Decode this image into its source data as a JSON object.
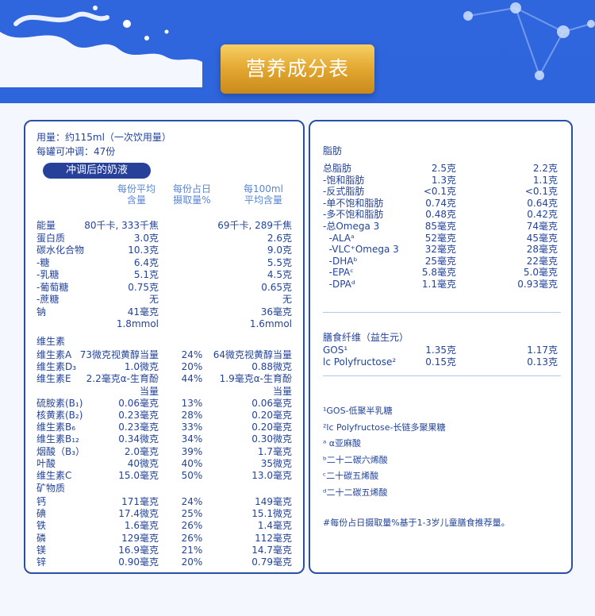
{
  "header": {
    "title": "营养成分表"
  },
  "left": {
    "dose": "用量：约115ml（一次饮用量）",
    "cans": "每罐可冲调：47份",
    "pill": "冲调后的奶液",
    "col1": [
      "每份平均",
      "含量"
    ],
    "col2": [
      "每份占日",
      "摄取量%"
    ],
    "col3": [
      "每100ml",
      "平均含量"
    ],
    "basic": [
      {
        "name": "能量",
        "a": "80千卡, 333千焦",
        "c": "69千卡, 289千焦"
      },
      {
        "name": "蛋白质",
        "a": "3.0克",
        "c": "2.6克"
      },
      {
        "name": "碳水化合物",
        "a": "10.3克",
        "c": "9.0克"
      },
      {
        "name": "-糖",
        "a": "6.4克",
        "c": "5.5克"
      },
      {
        "name": "-乳糖",
        "a": "5.1克",
        "c": "4.5克"
      },
      {
        "name": "-葡萄糖",
        "a": "0.75克",
        "c": "0.65克"
      },
      {
        "name": "-蔗糖",
        "a": "无",
        "c": "无"
      },
      {
        "name": "钠",
        "a": "41毫克",
        "c": "36毫克"
      },
      {
        "name": "",
        "a": "1.8mmol",
        "c": "1.6mmol"
      }
    ],
    "vit_title": "维生素",
    "vitamins": [
      {
        "name": "维生素A",
        "a": "73微克视黄醇当量",
        "p": "24%",
        "c": "64微克视黄醇当量"
      },
      {
        "name": "维生素D₃",
        "a": "1.0微克",
        "p": "20%",
        "c": "0.88微克"
      },
      {
        "name": "维生素E",
        "a": "2.2毫克α-生育酚",
        "p": "44%",
        "c": "1.9毫克α-生育酚"
      },
      {
        "name": "",
        "a": "当量",
        "p": "",
        "c": "当量"
      },
      {
        "name": "硫胺素(B₁)",
        "a": "0.06毫克",
        "p": "13%",
        "c": "0.06毫克"
      },
      {
        "name": "核黄素(B₂)",
        "a": "0.23毫克",
        "p": "28%",
        "c": "0.20毫克"
      },
      {
        "name": "维生素B₆",
        "a": "0.23毫克",
        "p": "33%",
        "c": "0.20毫克"
      },
      {
        "name": "维生素B₁₂",
        "a": "0.34微克",
        "p": "34%",
        "c": "0.30微克"
      },
      {
        "name": "烟酸（B₃）",
        "a": "2.0毫克",
        "p": "39%",
        "c": "1.7毫克"
      },
      {
        "name": "叶酸",
        "a": "40微克",
        "p": "40%",
        "c": "35微克"
      },
      {
        "name": "维生素C",
        "a": "15.0毫克",
        "p": "50%",
        "c": "13.0毫克"
      }
    ],
    "min_title": "矿物质",
    "minerals": [
      {
        "name": "钙",
        "a": "171毫克",
        "p": "24%",
        "c": "149毫克"
      },
      {
        "name": "碘",
        "a": "17.4微克",
        "p": "25%",
        "c": "15.1微克"
      },
      {
        "name": "铁",
        "a": "1.6毫克",
        "p": "26%",
        "c": "1.4毫克"
      },
      {
        "name": "磷",
        "a": "129毫克",
        "p": "26%",
        "c": "112毫克"
      },
      {
        "name": "镁",
        "a": "16.9毫克",
        "p": "21%",
        "c": "14.7毫克"
      },
      {
        "name": "锌",
        "a": "0.90毫克",
        "p": "20%",
        "c": "0.79毫克"
      }
    ]
  },
  "right": {
    "fat_title": "脂肪",
    "fats": [
      {
        "name": "总脂肪",
        "a": "2.5克",
        "c": "2.2克"
      },
      {
        "name": "-饱和脂肪",
        "a": "1.3克",
        "c": "1.1克"
      },
      {
        "name": "-反式脂肪",
        "a": "<0.1克",
        "c": "<0.1克"
      },
      {
        "name": "-单不饱和脂肪",
        "a": "0.74克",
        "c": "0.64克"
      },
      {
        "name": "-多不饱和脂肪",
        "a": "0.48克",
        "c": "0.42克"
      },
      {
        "name": "-总Omega 3",
        "a": "85毫克",
        "c": "74毫克"
      },
      {
        "name": "  -ALAᵃ",
        "a": "52毫克",
        "c": "45毫克"
      },
      {
        "name": "  -VLC⁺Omega 3",
        "a": "32毫克",
        "c": "28毫克"
      },
      {
        "name": "  -DHAᵇ",
        "a": "25毫克",
        "c": "22毫克"
      },
      {
        "name": "  -EPAᶜ",
        "a": "5.8毫克",
        "c": "5.0毫克"
      },
      {
        "name": "  -DPAᵈ",
        "a": "1.1毫克",
        "c": "0.93毫克"
      }
    ],
    "fiber_title": "膳食纤维（益生元）",
    "fibers": [
      {
        "name": "GOS¹",
        "a": "1.35克",
        "c": "1.17克"
      },
      {
        "name": "lc Polyfructose²",
        "a": "0.15克",
        "c": "0.13克"
      }
    ],
    "notes": [
      "¹GOS-低聚半乳糖",
      "²lc Polyfructose-长链多聚果糖",
      "ᵃ α亚麻酸",
      "ᵇ二十二碳六烯酸",
      "ᶜ二十碳五烯酸",
      "ᵈ二十二碳五烯酸"
    ],
    "footnote": "#每份占日摄取量%基于1-3岁儿童膳食推荐量。"
  }
}
